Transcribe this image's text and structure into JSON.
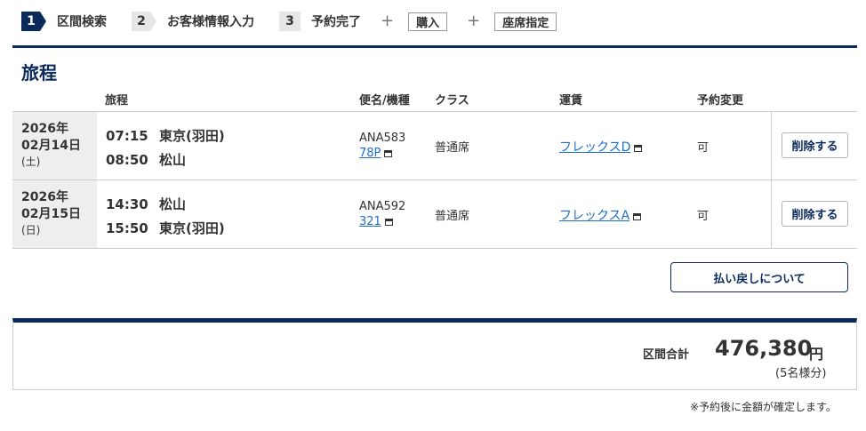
{
  "stepper": {
    "steps": [
      {
        "num": "1",
        "label": "区間検索"
      },
      {
        "num": "2",
        "label": "お客様情報入力"
      },
      {
        "num": "3",
        "label": "予約完了"
      }
    ],
    "plus": "+",
    "extra": [
      "購入",
      "座席指定"
    ]
  },
  "section_title": "旅程",
  "table": {
    "headers": {
      "itinerary": "旅程",
      "flight": "便名/機種",
      "class": "クラス",
      "fare": "運賃",
      "change": "予約変更"
    },
    "rows": [
      {
        "year": "2026年",
        "date": "02月14日",
        "dow": "(土)",
        "dep_time": "07:15",
        "dep_place": "東京(羽田)",
        "arr_time": "08:50",
        "arr_place": "松山",
        "flight_no": "ANA583",
        "aircraft": "78P",
        "class": "普通席",
        "fare": "フレックスD",
        "change": "可",
        "delete": "削除する"
      },
      {
        "year": "2026年",
        "date": "02月15日",
        "dow": "(日)",
        "dep_time": "14:30",
        "dep_place": "松山",
        "arr_time": "15:50",
        "arr_place": "東京(羽田)",
        "flight_no": "ANA592",
        "aircraft": "321",
        "class": "普通席",
        "fare": "フレックスA",
        "change": "可",
        "delete": "削除する"
      }
    ]
  },
  "refund_button": "払い戻しについて",
  "total": {
    "label": "区間合計",
    "amount": "476,380",
    "currency": "円",
    "people": "(5名様分)"
  },
  "footnote": "※予約後に金額が確定します。",
  "colors": {
    "navy": "#0b2a5c",
    "link": "#1f6fc7",
    "date_bg": "#eeeeee"
  }
}
